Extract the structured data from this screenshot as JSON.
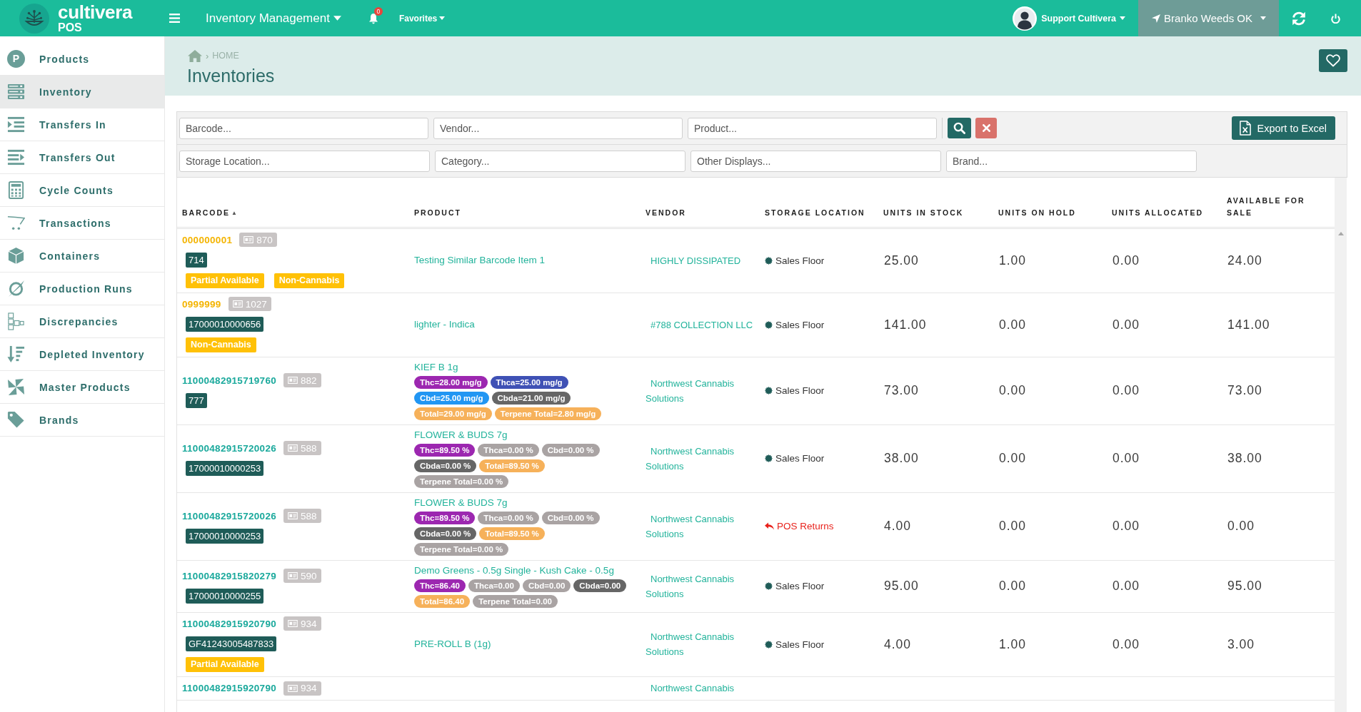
{
  "topbar": {
    "logo": {
      "name": "cultivera",
      "subtitle": "POS"
    },
    "module_menu": "Inventory Management",
    "notification_count": "0",
    "favorites": "Favorites",
    "user": "Support Cultivera",
    "location": "Branko Weeds OK"
  },
  "sidebar": {
    "items": [
      {
        "label": "Products",
        "icon_letter": "P",
        "selected": false
      },
      {
        "label": "Inventory",
        "selected": true
      },
      {
        "label": "Transfers In",
        "selected": false
      },
      {
        "label": "Transfers Out",
        "selected": false
      },
      {
        "label": "Cycle Counts",
        "selected": false
      },
      {
        "label": "Transactions",
        "selected": false
      },
      {
        "label": "Containers",
        "selected": false
      },
      {
        "label": "Production Runs",
        "selected": false
      },
      {
        "label": "Discrepancies",
        "selected": false
      },
      {
        "label": "Depleted Inventory",
        "selected": false
      },
      {
        "label": "Master Products",
        "selected": false
      },
      {
        "label": "Brands",
        "selected": false
      }
    ]
  },
  "header": {
    "breadcrumb_separator": "›",
    "breadcrumb": [
      "HOME"
    ],
    "title": "Inventories"
  },
  "filters": {
    "row_1": [
      {
        "placeholder": "Barcode..."
      },
      {
        "placeholder": "Vendor..."
      },
      {
        "placeholder": "Product..."
      }
    ],
    "row_2": [
      {
        "placeholder": "Storage Location..."
      },
      {
        "placeholder": "Category..."
      },
      {
        "placeholder": "Other Displays..."
      },
      {
        "placeholder": "Brand..."
      }
    ],
    "export_button": "Export to Excel"
  },
  "table": {
    "columns": [
      {
        "label": "BARCODE",
        "sort_mark": "▲"
      },
      {
        "label": "PRODUCT"
      },
      {
        "label": "VENDOR"
      },
      {
        "label": "STORAGE LOCATION"
      },
      {
        "label": "UNITS IN STOCK"
      },
      {
        "label": "UNITS ON HOLD"
      },
      {
        "label": "UNITS ALLOCATED"
      },
      {
        "label": "AVAILABLE FOR SALE"
      }
    ],
    "rows": [
      {
        "barcode": {
          "text": "000000001",
          "color": "#f4b400"
        },
        "count": "870",
        "code": "714",
        "tags": [
          "Partial Available",
          "Non-Cannabis"
        ],
        "product": "Testing Similar Barcode Item 1",
        "vendor": "HIGHLY DISSIPATED",
        "storage": {
          "kind": "floor",
          "name": "Sales Floor"
        },
        "units_in_stock": "25.00",
        "units_on_hold": "1.00",
        "units_allocated": "0.00",
        "available_for_sale": "24.00"
      },
      {
        "barcode": {
          "text": "0999999",
          "color": "#f4b400"
        },
        "count": "1027",
        "code": "17000010000656",
        "tags": [
          "Non-Cannabis"
        ],
        "product": "lighter - Indica",
        "vendor": "#788 COLLECTION LLC",
        "storage": {
          "kind": "floor",
          "name": "Sales Floor"
        },
        "units_in_stock": "141.00",
        "units_on_hold": "0.00",
        "units_allocated": "0.00",
        "available_for_sale": "141.00"
      },
      {
        "barcode": {
          "text": "11000482915719760",
          "color": "#1aa99c"
        },
        "count": "882",
        "code": "777",
        "product": "KIEF B 1g",
        "potency": [
          {
            "text": "Thc=28.00 mg/g",
            "color": "#9c27b0"
          },
          {
            "text": "Thca=25.00 mg/g",
            "color": "#3f51b5"
          },
          {
            "text": "Cbd=25.00 mg/g",
            "color": "#2196f3"
          },
          {
            "text": "Cbda=21.00 mg/g",
            "color": "#666666"
          },
          {
            "text": "Total=29.00 mg/g",
            "color": "#f6b15a"
          },
          {
            "text": "Terpene Total=2.80 mg/g",
            "color": "#f6b15a"
          }
        ],
        "vendor": "Northwest Cannabis Solutions",
        "storage": {
          "kind": "floor",
          "name": "Sales Floor"
        },
        "units_in_stock": "73.00",
        "units_on_hold": "0.00",
        "units_allocated": "0.00",
        "available_for_sale": "73.00"
      },
      {
        "barcode": {
          "text": "11000482915720026",
          "color": "#1aa99c"
        },
        "count": "588",
        "code": "17000010000253",
        "product": "FLOWER & BUDS 7g",
        "potency": [
          {
            "text": "Thc=89.50 %",
            "color": "#9c27b0"
          },
          {
            "text": "Thca=0.00 %",
            "color": "#a9a3a3"
          },
          {
            "text": "Cbd=0.00 %",
            "color": "#a9a3a3"
          },
          {
            "text": "Cbda=0.00 %",
            "color": "#666666"
          },
          {
            "text": "Total=89.50 %",
            "color": "#f6b15a"
          },
          {
            "text": "Terpene Total=0.00 %",
            "color": "#a9a3a3"
          }
        ],
        "vendor": "Northwest Cannabis Solutions",
        "storage": {
          "kind": "floor",
          "name": "Sales Floor"
        },
        "units_in_stock": "38.00",
        "units_on_hold": "0.00",
        "units_allocated": "0.00",
        "available_for_sale": "38.00"
      },
      {
        "barcode": {
          "text": "11000482915720026",
          "color": "#1aa99c"
        },
        "count": "588",
        "code": "17000010000253",
        "product": "FLOWER & BUDS 7g",
        "potency": [
          {
            "text": "Thc=89.50 %",
            "color": "#9c27b0"
          },
          {
            "text": "Thca=0.00 %",
            "color": "#a9a3a3"
          },
          {
            "text": "Cbd=0.00 %",
            "color": "#a9a3a3"
          },
          {
            "text": "Cbda=0.00 %",
            "color": "#666666"
          },
          {
            "text": "Total=89.50 %",
            "color": "#f6b15a"
          },
          {
            "text": "Terpene Total=0.00 %",
            "color": "#a9a3a3"
          }
        ],
        "vendor": "Northwest Cannabis Solutions",
        "storage": {
          "kind": "returns",
          "name": "POS Returns"
        },
        "units_in_stock": "4.00",
        "units_on_hold": "0.00",
        "units_allocated": "0.00",
        "available_for_sale": "0.00"
      },
      {
        "barcode": {
          "text": "11000482915820279",
          "color": "#1aa99c"
        },
        "count": "590",
        "code": "17000010000255",
        "product": "Demo Greens - 0.5g Single - Kush Cake - 0.5g",
        "potency": [
          {
            "text": "Thc=86.40",
            "color": "#9c27b0"
          },
          {
            "text": "Thca=0.00",
            "color": "#a9a3a3"
          },
          {
            "text": "Cbd=0.00",
            "color": "#a9a3a3"
          },
          {
            "text": "Cbda=0.00",
            "color": "#666666"
          },
          {
            "text": "Total=86.40",
            "color": "#f6b15a"
          },
          {
            "text": "Terpene Total=0.00",
            "color": "#a9a3a3"
          }
        ],
        "vendor": "Northwest Cannabis Solutions",
        "storage": {
          "kind": "floor",
          "name": "Sales Floor"
        },
        "units_in_stock": "95.00",
        "units_on_hold": "0.00",
        "units_allocated": "0.00",
        "available_for_sale": "95.00"
      },
      {
        "barcode": {
          "text": "11000482915920790",
          "color": "#1aa99c"
        },
        "count": "934",
        "code": "GF41243005487833",
        "tags": [
          "Partial Available"
        ],
        "product": "PRE-ROLL B (1g)",
        "vendor": "Northwest Cannabis Solutions",
        "storage": {
          "kind": "floor",
          "name": "Sales Floor"
        },
        "units_in_stock": "4.00",
        "units_on_hold": "1.00",
        "units_allocated": "0.00",
        "available_for_sale": "3.00"
      },
      {
        "barcode": {
          "text": "11000482915920790",
          "color": "#1aa99c"
        },
        "count": "934",
        "vendor": "Northwest Cannabis"
      }
    ]
  }
}
